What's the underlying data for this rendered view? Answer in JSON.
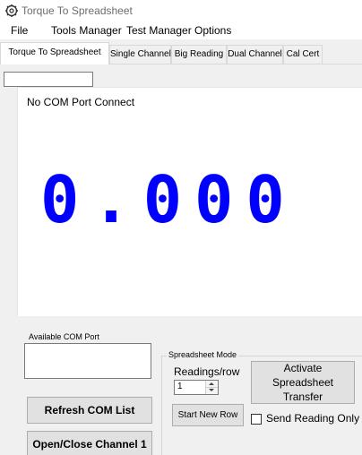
{
  "window": {
    "title": "Torque To Spreadsheet",
    "icon": "gear-app-icon"
  },
  "menu": [
    "File",
    "Tools Manager",
    "Test Manager",
    "Options"
  ],
  "tabs": [
    {
      "label": "Torque To Spreadsheet",
      "active": true
    },
    {
      "label": "Single Channel",
      "active": false
    },
    {
      "label": "Big Reading",
      "active": false
    },
    {
      "label": "Dual Channel",
      "active": false
    },
    {
      "label": "Cal Cert",
      "active": false
    }
  ],
  "top_input": {
    "value": ""
  },
  "display": {
    "status": "No COM Port Connect",
    "reading": "0.000",
    "reading_color": "#0000ff"
  },
  "com": {
    "label": "Available COM Port",
    "refresh_button": "Refresh COM List",
    "open_close_button": "Open/Close Channel 1"
  },
  "spreadsheet_mode": {
    "legend": "Spreadsheet Mode",
    "readings_label": "Readings/row",
    "readings_value": "1",
    "activate_button": "Activate Spreadsheet Transfer",
    "start_row_button": "Start New Row",
    "send_reading_only_label": "Send Reading Only",
    "send_reading_only_checked": false
  }
}
